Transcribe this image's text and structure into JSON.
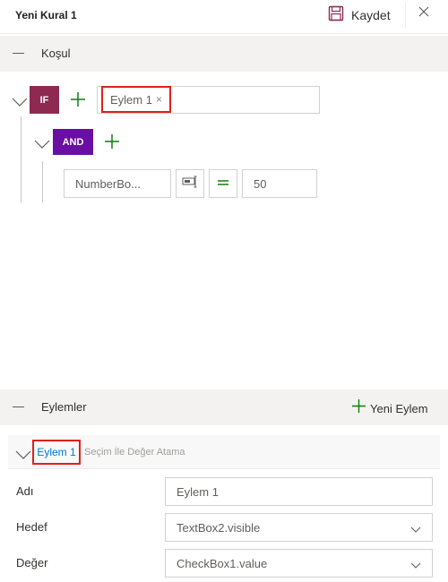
{
  "header": {
    "title": "Yeni Kural 1",
    "save_label": "Kaydet"
  },
  "condition": {
    "section_title": "Koşul",
    "if_label": "IF",
    "and_label": "AND",
    "action_chip": {
      "label": "Eylem 1",
      "remove": "×"
    },
    "row": {
      "field_value": "NumberBo...",
      "compare_value": "50"
    }
  },
  "actions": {
    "section_title": "Eylemler",
    "new_action_label": "Yeni Eylem",
    "item": {
      "name": "Eylem 1",
      "description": "Seçim İle Değer Atama"
    },
    "form": {
      "name_label": "Adı",
      "name_value": "Eylem 1",
      "target_label": "Hedef",
      "target_value": "TextBox2.visible",
      "value_label": "Değer",
      "value_value": "CheckBox1.value"
    }
  },
  "colors": {
    "if": "#8e2a52",
    "and": "#6a0fa3",
    "plus": "#107c10",
    "highlight": "#e0201b",
    "link": "#0078d4"
  },
  "icons": [
    "save-icon",
    "close-icon",
    "minus-icon",
    "chevron-down-icon",
    "plus-icon",
    "field-picker-icon",
    "equals-icon"
  ]
}
